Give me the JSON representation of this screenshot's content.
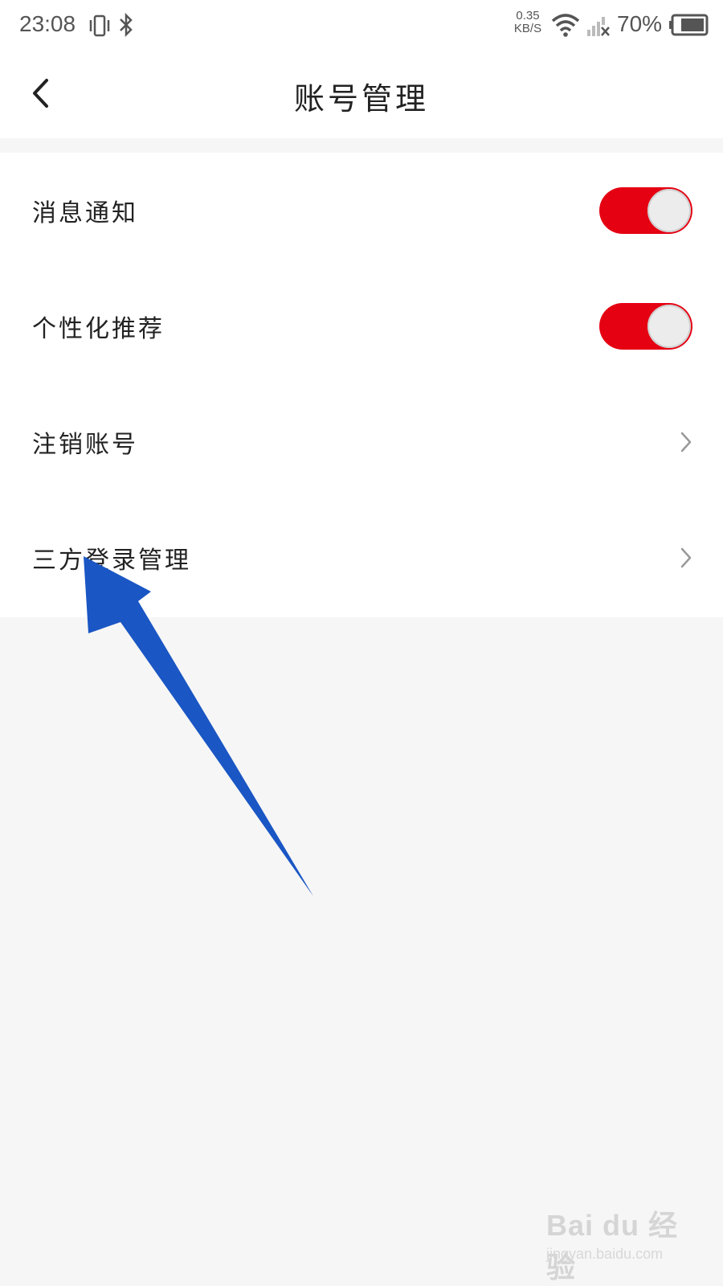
{
  "status_bar": {
    "time": "23:08",
    "net_speed_value": "0.35",
    "net_speed_unit": "KB/S",
    "battery_percent": "70%",
    "icons": [
      "vibrate-icon",
      "bluetooth-icon",
      "wifi-icon",
      "signal-icon",
      "battery-icon"
    ]
  },
  "header": {
    "title": "账号管理",
    "back_icon": "chevron-left-icon"
  },
  "settings": {
    "items": [
      {
        "label": "消息通知",
        "control": "toggle",
        "on": true
      },
      {
        "label": "个性化推荐",
        "control": "toggle",
        "on": true
      },
      {
        "label": "注销账号",
        "control": "chevron",
        "icon": "chevron-right-icon"
      },
      {
        "label": "三方登录管理",
        "control": "chevron",
        "icon": "chevron-right-icon"
      }
    ]
  },
  "watermark": {
    "logo": "Bai du 经验",
    "url": "jingyan.baidu.com"
  },
  "colors": {
    "toggle_on": "#e50012",
    "annotation_arrow": "#1a56c4",
    "page_background": "#f6f6f6"
  }
}
